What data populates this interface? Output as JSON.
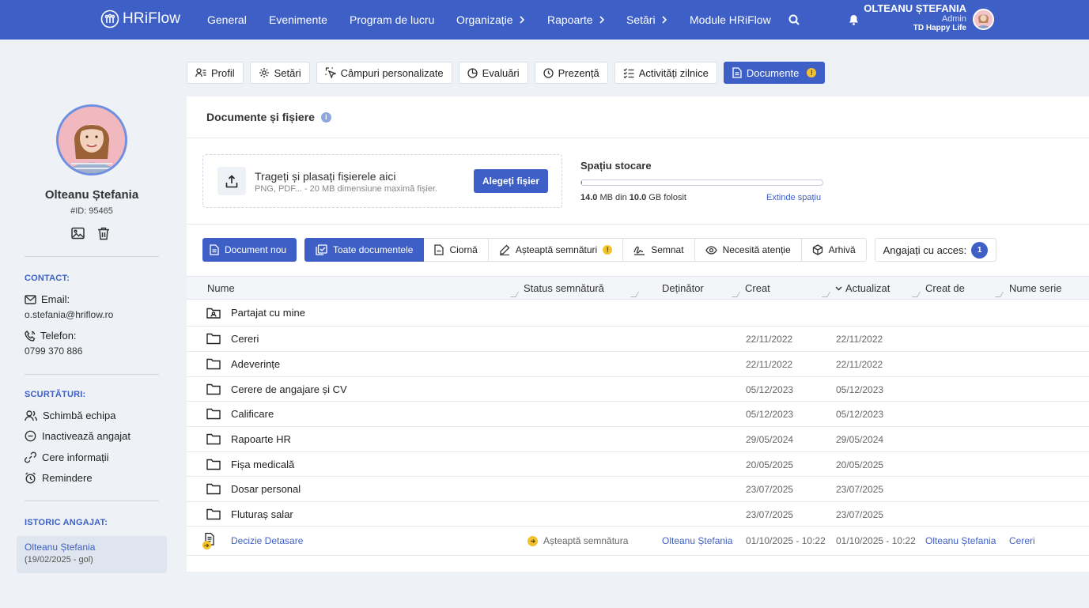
{
  "colors": {
    "accent": "#3d5fc6",
    "warning": "#f2c12e",
    "background": "#eef1f6"
  },
  "topnav": {
    "logo_text": "HRiFlow",
    "items": [
      "General",
      "Evenimente",
      "Program de lucru",
      "Organizație",
      "Rapoarte",
      "Setări",
      "Module HRiFlow"
    ],
    "user": {
      "name": "OLTEANU ȘTEFANIA",
      "role": "Admin",
      "company": "TD Happy Life"
    }
  },
  "profile": {
    "name": "Olteanu Ștefania",
    "id": "#ID: 95465",
    "contact_title": "CONTACT:",
    "email_label": "Email:",
    "email": "o.stefania@hriflow.ro",
    "phone_label": "Telefon:",
    "phone": "0799 370 886",
    "shortcuts_title": "SCURTĂTURI:",
    "shortcuts": [
      "Schimbă echipa",
      "Inactivează angajat",
      "Cere informații",
      "Remindere"
    ],
    "history_title": "ISTORIC ANGAJAT:",
    "history_name": "Olteanu Ștefania",
    "history_period": "(19/02/2025 - gol)"
  },
  "tabs": [
    "Profil",
    "Setări",
    "Câmpuri personalizate",
    "Evaluări",
    "Prezență",
    "Activități zilnice",
    "Documente"
  ],
  "tab_badge": "!",
  "panel": {
    "title": "Documente și fișiere",
    "info": "i",
    "upload": {
      "title": "Trageți și plasați fișierele aici",
      "hint": "PNG, PDF... - 20 MB dimensiune maximă fișier.",
      "button": "Alegeți fișier"
    },
    "storage": {
      "title": "Spațiu stocare",
      "used": "14.0",
      "used_unit": "MB din",
      "total": "10.0",
      "total_unit": "GB folosit",
      "used_fraction": 0.0014,
      "link": "Extinde spațiu"
    }
  },
  "filters": {
    "new_doc": "Document nou",
    "segments": [
      "Toate documentele",
      "Ciornă",
      "Așteaptă semnături",
      "Semnat",
      "Necesită atenție",
      "Arhivă"
    ],
    "warn_badge": "!",
    "access_label": "Angajați cu acces:",
    "access_count": "1"
  },
  "table": {
    "columns": [
      "Nume",
      "Status semnătură",
      "Deținător",
      "Creat",
      "Actualizat",
      "Creat de",
      "Nume serie"
    ],
    "shared_folder": "Partajat cu mine",
    "folders": [
      {
        "name": "Cereri",
        "created": "22/11/2022",
        "updated": "22/11/2022"
      },
      {
        "name": "Adeverințe",
        "created": "22/11/2022",
        "updated": "22/11/2022"
      },
      {
        "name": "Cerere de angajare și CV",
        "created": "05/12/2023",
        "updated": "05/12/2023"
      },
      {
        "name": "Calificare",
        "created": "05/12/2023",
        "updated": "05/12/2023"
      },
      {
        "name": "Rapoarte HR",
        "created": "29/05/2024",
        "updated": "29/05/2024"
      },
      {
        "name": "Fișa medicală",
        "created": "20/05/2025",
        "updated": "20/05/2025"
      },
      {
        "name": "Dosar personal",
        "created": "23/07/2025",
        "updated": "23/07/2025"
      },
      {
        "name": "Fluturaș salar",
        "created": "23/07/2025",
        "updated": "23/07/2025"
      }
    ],
    "document": {
      "name": "Decizie Detasare",
      "status": "Așteaptă semnătura",
      "owner": "Olteanu Ștefania",
      "created": "01/10/2025 - 10:22",
      "updated": "01/10/2025 - 10:22",
      "created_by": "Olteanu Ștefania",
      "series": "Cereri"
    }
  }
}
